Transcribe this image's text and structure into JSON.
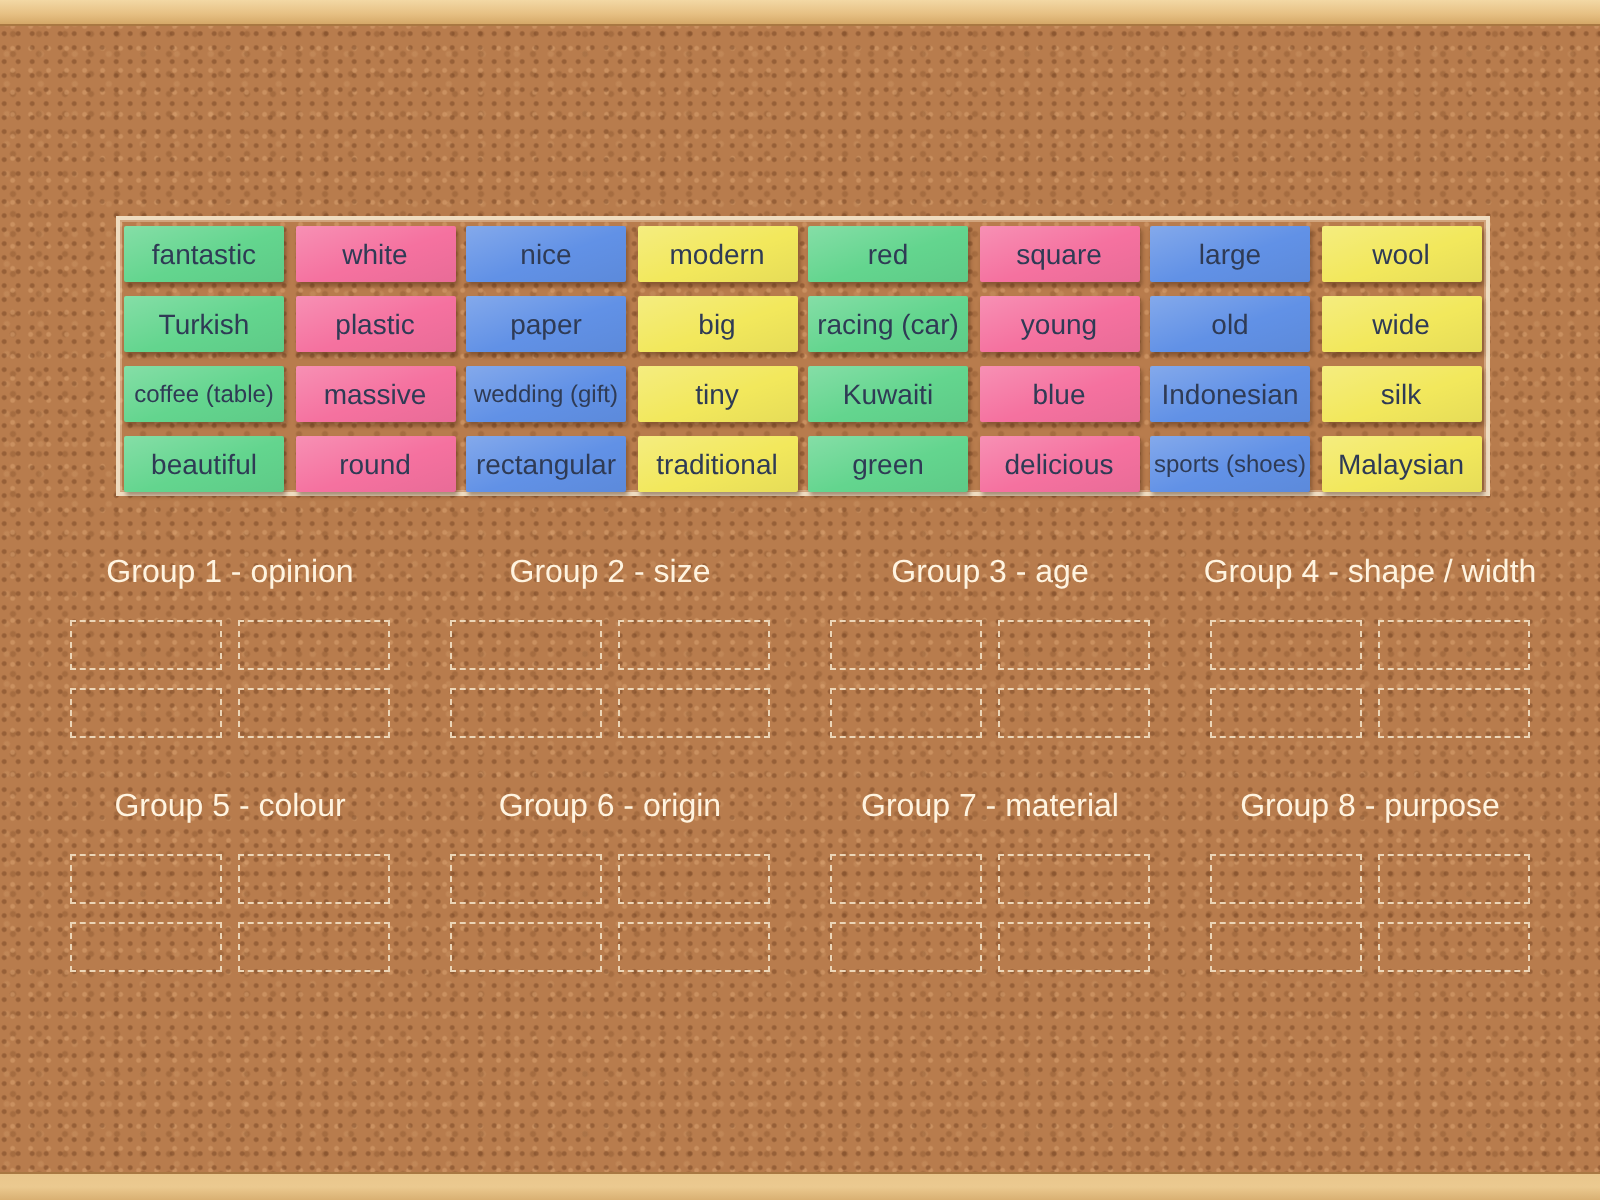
{
  "tray": {
    "tiles": [
      {
        "text": "fantastic",
        "color": "#63d58e"
      },
      {
        "text": "white",
        "color": "#f5719f"
      },
      {
        "text": "nice",
        "color": "#6191e6"
      },
      {
        "text": "modern",
        "color": "#f2e85c"
      },
      {
        "text": "red",
        "color": "#63d58e"
      },
      {
        "text": "square",
        "color": "#f5719f"
      },
      {
        "text": "large",
        "color": "#6191e6"
      },
      {
        "text": "wool",
        "color": "#f2e85c"
      },
      {
        "text": "Turkish",
        "color": "#63d58e"
      },
      {
        "text": "plastic",
        "color": "#f5719f"
      },
      {
        "text": "paper",
        "color": "#6191e6"
      },
      {
        "text": "big",
        "color": "#f2e85c"
      },
      {
        "text": "racing (car)",
        "color": "#63d58e"
      },
      {
        "text": "young",
        "color": "#f5719f"
      },
      {
        "text": "old",
        "color": "#6191e6"
      },
      {
        "text": "wide",
        "color": "#f2e85c"
      },
      {
        "text": "coffee (table)",
        "color": "#63d58e"
      },
      {
        "text": "massive",
        "color": "#f5719f"
      },
      {
        "text": "wedding (gift)",
        "color": "#6191e6"
      },
      {
        "text": "tiny",
        "color": "#f2e85c"
      },
      {
        "text": "Kuwaiti",
        "color": "#63d58e"
      },
      {
        "text": "blue",
        "color": "#f5719f"
      },
      {
        "text": "Indonesian",
        "color": "#6191e6"
      },
      {
        "text": "silk",
        "color": "#f2e85c"
      },
      {
        "text": "beautiful",
        "color": "#63d58e"
      },
      {
        "text": "round",
        "color": "#f5719f"
      },
      {
        "text": "rectangular",
        "color": "#6191e6"
      },
      {
        "text": "traditional",
        "color": "#f2e85c"
      },
      {
        "text": "green",
        "color": "#63d58e"
      },
      {
        "text": "delicious",
        "color": "#f5719f"
      },
      {
        "text": "sports (shoes)",
        "color": "#6191e6"
      },
      {
        "text": "Malaysian",
        "color": "#f2e85c"
      }
    ]
  },
  "groups": [
    {
      "title": "Group 1 - opinion",
      "slots": [
        {
          "filled": false
        },
        {
          "filled": false
        },
        {
          "filled": false
        },
        {
          "filled": false
        }
      ]
    },
    {
      "title": "Group 2 - size",
      "slots": [
        {
          "filled": false
        },
        {
          "filled": false
        },
        {
          "filled": false
        },
        {
          "filled": false
        }
      ]
    },
    {
      "title": "Group 3 - age",
      "slots": [
        {
          "filled": false
        },
        {
          "filled": false
        },
        {
          "filled": false
        },
        {
          "filled": false
        }
      ]
    },
    {
      "title": "Group 4 - shape / width",
      "slots": [
        {
          "filled": false
        },
        {
          "filled": false
        },
        {
          "filled": false
        },
        {
          "filled": false
        }
      ]
    },
    {
      "title": "Group 5 - colour",
      "slots": [
        {
          "filled": false
        },
        {
          "filled": false
        },
        {
          "filled": false
        },
        {
          "filled": false
        }
      ]
    },
    {
      "title": "Group 6 - origin",
      "slots": [
        {
          "filled": false
        },
        {
          "filled": false
        },
        {
          "filled": false
        },
        {
          "filled": false
        }
      ]
    },
    {
      "title": "Group 7 - material",
      "slots": [
        {
          "filled": false
        },
        {
          "filled": false
        },
        {
          "filled": false
        },
        {
          "filled": false
        }
      ]
    },
    {
      "title": "Group 8 - purpose",
      "slots": [
        {
          "filled": false
        },
        {
          "filled": false
        },
        {
          "filled": false
        },
        {
          "filled": false
        }
      ]
    }
  ]
}
